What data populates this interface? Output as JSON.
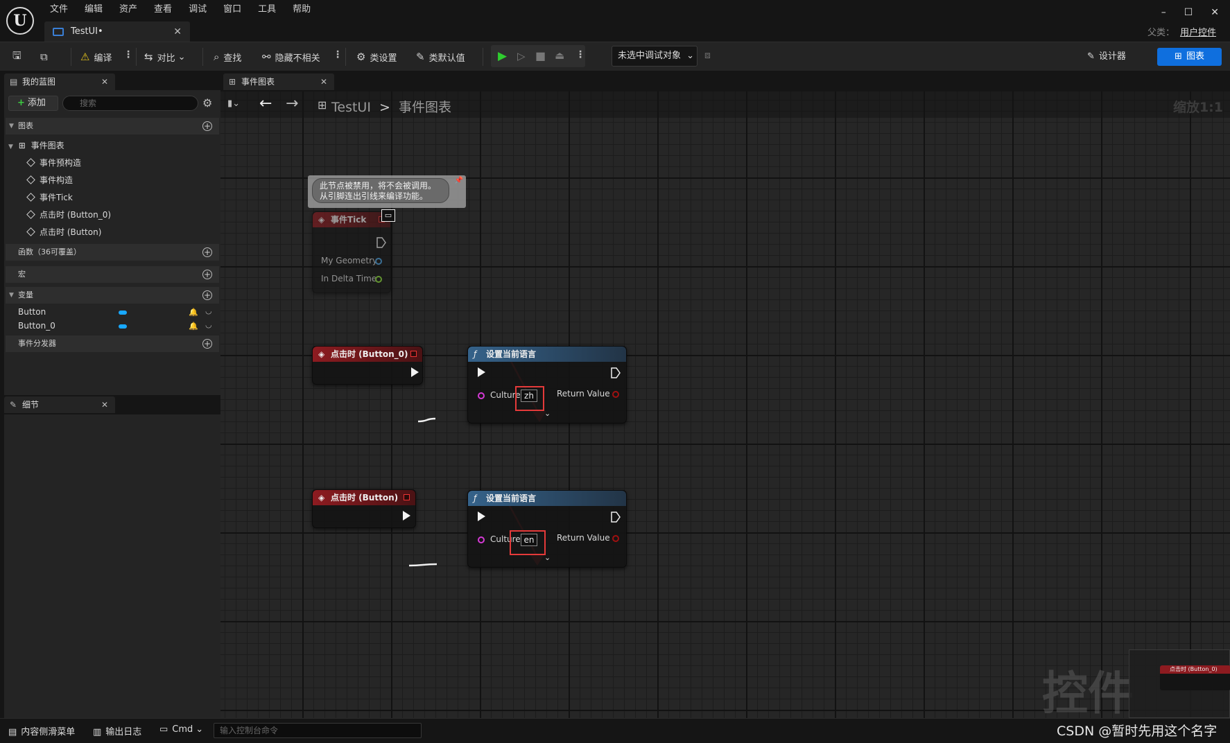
{
  "titlebar": {
    "logo": "U",
    "menu": [
      "文件",
      "编辑",
      "资产",
      "查看",
      "调试",
      "窗口",
      "工具",
      "帮助"
    ],
    "doc_tab": "TestUI•",
    "parent_label": "父类：",
    "parent_value": "用户控件",
    "window_controls": [
      "–",
      "☐",
      "✕"
    ]
  },
  "toolbar": {
    "compile": "编译",
    "diff": "对比",
    "find": "查找",
    "hide_unrelated": "隐藏不相关",
    "class_settings": "类设置",
    "class_defaults": "类默认值",
    "debug_object": "未选中调试对象",
    "designer": "设计器",
    "graph": "图表"
  },
  "my_blueprint": {
    "tab": "我的蓝图",
    "add": "添加",
    "search_placeholder": "搜索",
    "graphs_section": "图表",
    "event_graph": "事件图表",
    "events": [
      "事件预构造",
      "事件构造",
      "事件Tick",
      "点击时 (Button_0)",
      "点击时 (Button)"
    ],
    "functions_section": "函数（36可覆盖）",
    "macros_section": "宏",
    "variables_section": "变量",
    "variables": [
      "Button",
      "Button_0"
    ],
    "dispatchers_section": "事件分发器"
  },
  "details": {
    "tab": "细节"
  },
  "graph": {
    "tab": "事件图表",
    "breadcrumb_root": "TestUI",
    "breadcrumb_sep": ">",
    "breadcrumb_current": "事件图表",
    "zoom": "缩放1:1",
    "watermark": "控件",
    "comment": [
      "此节点被禁用，将不会被调用。",
      "从引脚连出引线来编译功能。"
    ],
    "tick_node": {
      "title": "事件Tick",
      "pins": [
        "My Geometry",
        "In Delta Time"
      ]
    },
    "click_node_0": {
      "title": "点击时 (Button_0)"
    },
    "click_node_1": {
      "title": "点击时 (Button)"
    },
    "set_lang_node_0": {
      "title": "设置当前语言",
      "culture_label": "Culture",
      "culture_value": "zh",
      "return_label": "Return Value"
    },
    "set_lang_node_1": {
      "title": "设置当前语言",
      "culture_label": "Culture",
      "culture_value": "en",
      "return_label": "Return Value"
    },
    "minimap_node": "点击时 (Button_0)"
  },
  "statusbar": {
    "content_drawer": "内容侧滑菜单",
    "output_log": "输出日志",
    "cmd": "Cmd",
    "console_placeholder": "输入控制台命令"
  },
  "watermark_text": "CSDN @暂时先用这个名字",
  "colors": {
    "accent": "#0f6fde",
    "event_header": "#8d1b20",
    "function_header": "#35628a",
    "annotation": "#e53a3a"
  }
}
